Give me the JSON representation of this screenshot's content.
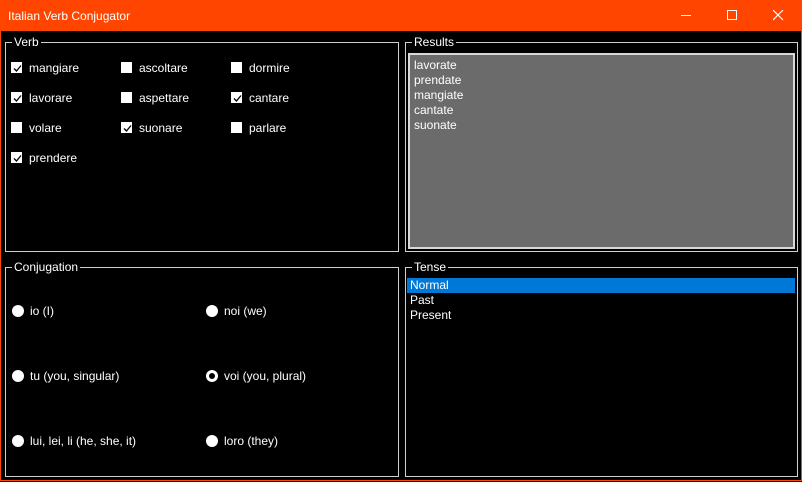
{
  "window": {
    "title": "Italian Verb Conjugator",
    "accent_color": "#ff4500",
    "controls": [
      "minimize-icon",
      "maximize-icon",
      "close-icon"
    ]
  },
  "verb_group": {
    "legend": "Verb",
    "items": [
      {
        "label": "mangiare",
        "checked": true
      },
      {
        "label": "ascoltare",
        "checked": false
      },
      {
        "label": "dormire",
        "checked": false
      },
      {
        "label": "lavorare",
        "checked": true
      },
      {
        "label": "aspettare",
        "checked": false
      },
      {
        "label": "cantare",
        "checked": true
      },
      {
        "label": "volare",
        "checked": false
      },
      {
        "label": "suonare",
        "checked": true
      },
      {
        "label": "parlare",
        "checked": false
      },
      {
        "label": "prendere",
        "checked": true
      }
    ]
  },
  "results_group": {
    "legend": "Results",
    "lines": [
      "lavorate",
      "prendate",
      "mangiate",
      "cantate",
      "suonate"
    ]
  },
  "conjugation_group": {
    "legend": "Conjugation",
    "options": [
      {
        "label": "io (I)",
        "checked": false
      },
      {
        "label": "noi (we)",
        "checked": false
      },
      {
        "label": "tu (you, singular)",
        "checked": false
      },
      {
        "label": "voi (you, plural)",
        "checked": true
      },
      {
        "label": "lui, lei, li (he, she, it)",
        "checked": false
      },
      {
        "label": "loro (they)",
        "checked": false
      }
    ]
  },
  "tense_group": {
    "legend": "Tense",
    "items": [
      {
        "label": "Normal",
        "selected": true
      },
      {
        "label": "Past",
        "selected": false
      },
      {
        "label": "Present",
        "selected": false
      }
    ],
    "selection_color": "#0078d7"
  }
}
